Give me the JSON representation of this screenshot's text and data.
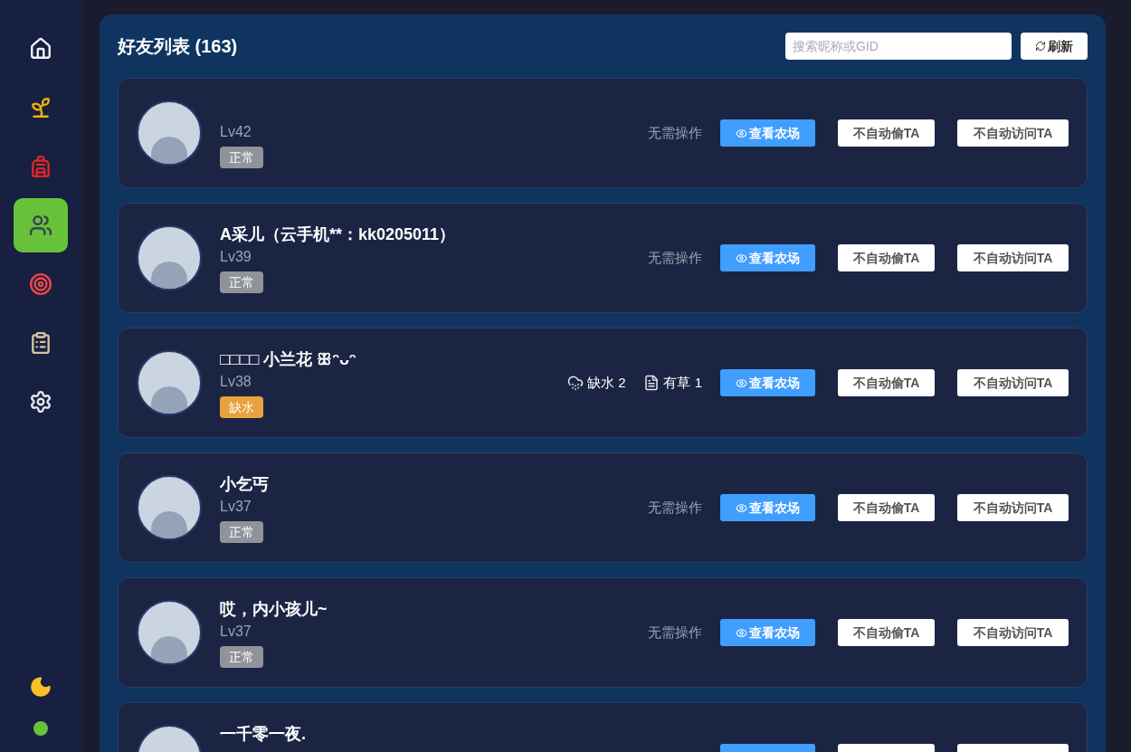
{
  "sidebar": {
    "items": [
      {
        "selected": false
      },
      {
        "selected": false
      },
      {
        "selected": false
      },
      {
        "selected": true
      },
      {
        "selected": false
      },
      {
        "selected": false
      },
      {
        "selected": false
      }
    ],
    "online": true
  },
  "panel": {
    "title": "好友列表 (163)",
    "search": {
      "placeholder": "搜索昵称或GID"
    },
    "refresh_button": "刷新"
  },
  "friends": [
    {
      "level": "Lv42",
      "status": {
        "label": "正常",
        "kind": "normal"
      },
      "note": "无需操作",
      "view_button": "查看农场",
      "steal_button": "不自动偷TA",
      "visit_button": "不自动访问TA"
    },
    {
      "name": "A采儿（云手机**：kk0205011）",
      "level": "Lv39",
      "status": {
        "label": "正常",
        "kind": "normal"
      },
      "note": "无需操作",
      "view_button": "查看农场",
      "steal_button": "不自动偷TA",
      "visit_button": "不自动访问TA"
    },
    {
      "name": "□□□□ 小兰花 ꕥᵔᴗᵔ",
      "level": "Lv38",
      "status": {
        "label": "缺水",
        "kind": "dry"
      },
      "stats": [
        {
          "kind": "water",
          "label": "缺水 2"
        },
        {
          "kind": "weed",
          "label": "有草 1"
        }
      ],
      "view_button": "查看农场",
      "steal_button": "不自动偷TA",
      "visit_button": "不自动访问TA"
    },
    {
      "name": "小乞丐",
      "level": "Lv37",
      "status": {
        "label": "正常",
        "kind": "normal"
      },
      "note": "无需操作",
      "view_button": "查看农场",
      "steal_button": "不自动偷TA",
      "visit_button": "不自动访问TA"
    },
    {
      "name": "哎，内小孩儿~",
      "level": "Lv37",
      "status": {
        "label": "正常",
        "kind": "normal"
      },
      "note": "无需操作",
      "view_button": "查看农场",
      "steal_button": "不自动偷TA",
      "visit_button": "不自动访问TA"
    },
    {
      "name": "一千零一夜."
    }
  ]
}
